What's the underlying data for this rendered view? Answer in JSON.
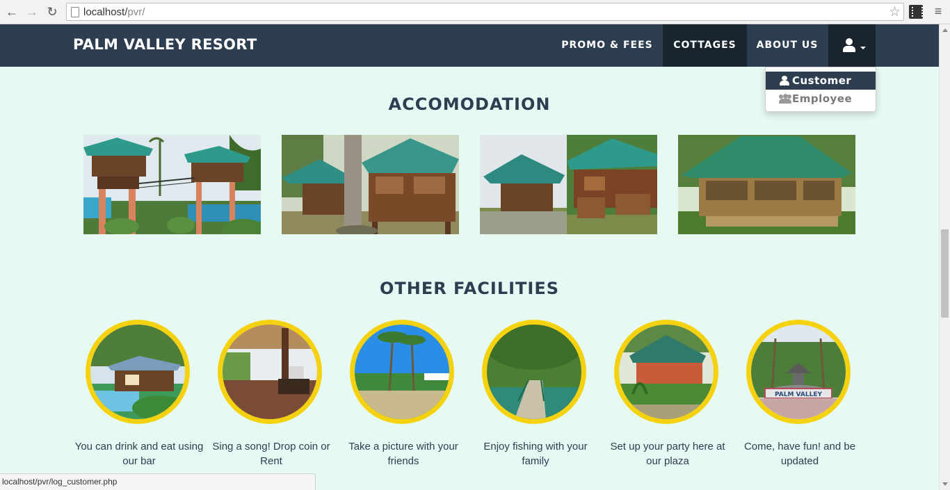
{
  "browser": {
    "url_host": "localhost/",
    "url_path": "pvr/",
    "status_url": "localhost/pvr/log_customer.php",
    "icons": {
      "back": "back-arrow-icon",
      "forward": "forward-arrow-icon",
      "reload": "reload-icon",
      "bookmark": "star-icon",
      "menu": "hamburger-menu-icon"
    }
  },
  "navbar": {
    "brand": "PALM VALLEY RESORT",
    "items": [
      {
        "label": "PROMO & FEES"
      },
      {
        "label": "COTTAGES"
      },
      {
        "label": "ABOUT US"
      }
    ],
    "user_menu": {
      "icon": "user-icon",
      "items": [
        {
          "label": "Customer",
          "icon": "user-icon"
        },
        {
          "label": "Employee",
          "icon": "users-icon"
        }
      ]
    },
    "colors": {
      "bar": "#2c3e50",
      "active": "#1a242f"
    }
  },
  "accommodation": {
    "title": "ACCOMODATION",
    "images": [
      "raised-cottage-photo",
      "nipa-hut-photo",
      "cottage-row-photo",
      "large-hut-photo"
    ]
  },
  "facilities": {
    "title": "OTHER FACILITIES",
    "items": [
      {
        "text": "You can drink and eat using our bar"
      },
      {
        "text": "Sing a song! Drop coin or Rent"
      },
      {
        "text": "Take a picture with your friends"
      },
      {
        "text": "Enjoy fishing with your family"
      },
      {
        "text": "Set up your party here at our plaza"
      },
      {
        "text": "Come, have fun! and be updated"
      }
    ],
    "sign_text": "PALM VALLEY",
    "ring_color": "#f5d20f"
  },
  "page_background": "#e6faf3"
}
